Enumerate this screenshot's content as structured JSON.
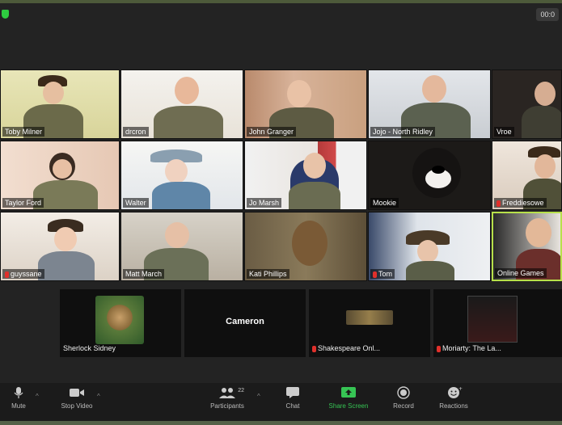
{
  "meeting": {
    "timer": "00:0"
  },
  "participants": [
    {
      "name": "Toby Milner",
      "muted": false
    },
    {
      "name": "drcron",
      "muted": false
    },
    {
      "name": "John Granger",
      "muted": false
    },
    {
      "name": "Jojo - North Ridley",
      "muted": false
    },
    {
      "name": "Vroe",
      "muted": false
    },
    {
      "name": "Taylor Ford",
      "muted": false
    },
    {
      "name": "Walter",
      "muted": false
    },
    {
      "name": "Jo Marsh",
      "muted": false
    },
    {
      "name": "Mookie",
      "muted": false
    },
    {
      "name": "Freddiesowe",
      "muted": true
    },
    {
      "name": "guyssane",
      "muted": true
    },
    {
      "name": "Matt March",
      "muted": false
    },
    {
      "name": "Kati Phillips",
      "muted": false
    },
    {
      "name": "Tom",
      "muted": true
    },
    {
      "name": "Online Games",
      "muted": false
    }
  ],
  "strip": [
    {
      "label": "Sherlock Sidney",
      "center": "",
      "muted": false
    },
    {
      "label": "",
      "center": "Cameron",
      "muted": false
    },
    {
      "label": "Shakespeare Onl...",
      "center": "",
      "muted": true
    },
    {
      "label": "Moriarty: The La...",
      "center": "",
      "muted": true
    }
  ],
  "toolbar": {
    "mute": "Mute",
    "stop_video": "Stop Video",
    "participants": "Participants",
    "participants_count": "22",
    "chat": "Chat",
    "share_screen": "Share Screen",
    "record": "Record",
    "reactions": "Reactions"
  },
  "colors": {
    "active_speaker": "#b7e04a",
    "share_green": "#36c454",
    "muted_red": "#e0302b"
  }
}
